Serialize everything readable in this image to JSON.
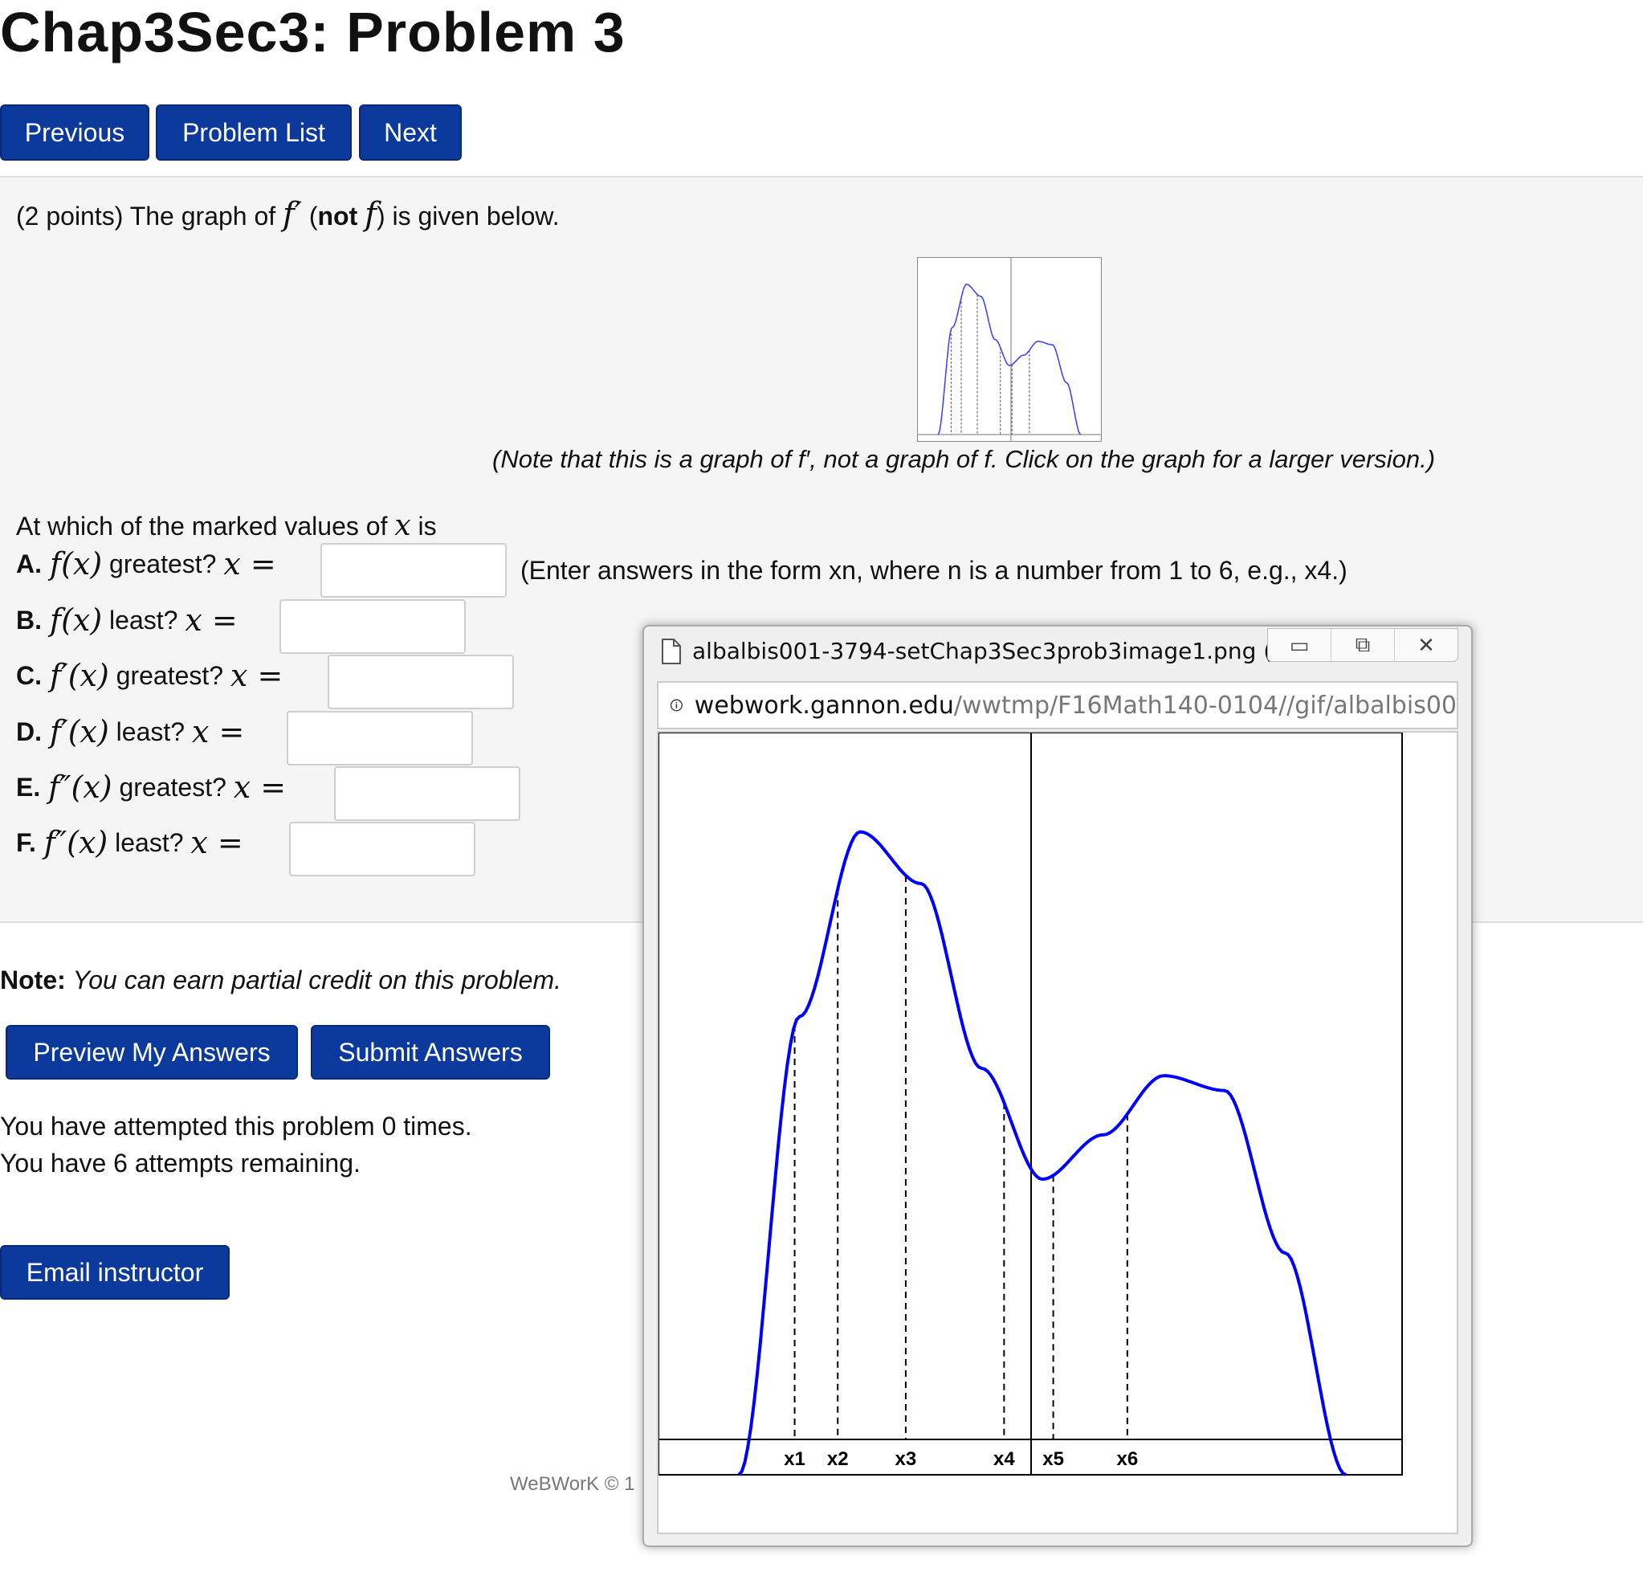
{
  "page": {
    "title": "Chap3Sec3: Problem 3"
  },
  "nav": {
    "previous": "Previous",
    "problem_list": "Problem List",
    "next": "Next"
  },
  "problem": {
    "intro_prefix": "(2 points) The graph of",
    "intro_fprime": "f′",
    "intro_paren_open": "(",
    "intro_not": "not",
    "intro_f": "f",
    "intro_suffix": ") is given below.",
    "graph_note": "(Note that this is a graph of f′, not a graph of f. Click on the graph for a larger version.)",
    "question_stem": "At which of the marked values of",
    "question_var": "x",
    "question_is": "is",
    "enter_hint": "(Enter answers in the form xn, where n is a number from 1 to 6, e.g., x4.)",
    "parts": [
      {
        "letter": "A.",
        "func": "f(x)",
        "word": "greatest?",
        "eq": "x =",
        "value": ""
      },
      {
        "letter": "B.",
        "func": "f(x)",
        "word": "least?",
        "eq": "x =",
        "value": ""
      },
      {
        "letter": "C.",
        "func": "f′(x)",
        "word": "greatest?",
        "eq": "x =",
        "value": ""
      },
      {
        "letter": "D.",
        "func": "f′(x)",
        "word": "least?",
        "eq": "x =",
        "value": ""
      },
      {
        "letter": "E.",
        "func": "f″(x)",
        "word": "greatest?",
        "eq": "x =",
        "value": ""
      },
      {
        "letter": "F.",
        "func": "f″(x)",
        "word": "least?",
        "eq": "x =",
        "value": ""
      }
    ]
  },
  "note": {
    "label": "Note:",
    "text": "You can earn partial credit on this problem."
  },
  "actions": {
    "preview": "Preview My Answers",
    "submit": "Submit Answers",
    "email": "Email instructor"
  },
  "attempts": {
    "line1": "You have attempted this problem 0 times.",
    "line2": "You have 6 attempts remaining."
  },
  "footer": "WeBWorK © 1",
  "popup": {
    "title": "albalbis001-3794-setChap3Sec3prob3image1.png (400...",
    "url_host": "webwork.gannon.edu",
    "url_path": "/wwtmp/F16Math140-0104//gif/albalbis00",
    "window_controls": [
      "minimize-icon",
      "restore-icon",
      "close-icon"
    ]
  },
  "chart_data": {
    "type": "line",
    "title": "",
    "xlabel": "",
    "ylabel": "",
    "color": "#0000ff",
    "marked_points": [
      "x1",
      "x2",
      "x3",
      "x4",
      "x5",
      "x6"
    ],
    "x": [
      0.0,
      0.5,
      1.0,
      1.5,
      2.0,
      2.5,
      3.0,
      3.5,
      4.0,
      4.5,
      5.0
    ],
    "series": [
      {
        "values": [
          0.0,
          0.62,
          0.87,
          0.8,
          0.55,
          0.4,
          0.46,
          0.54,
          0.52,
          0.3,
          0.0
        ]
      }
    ]
  }
}
